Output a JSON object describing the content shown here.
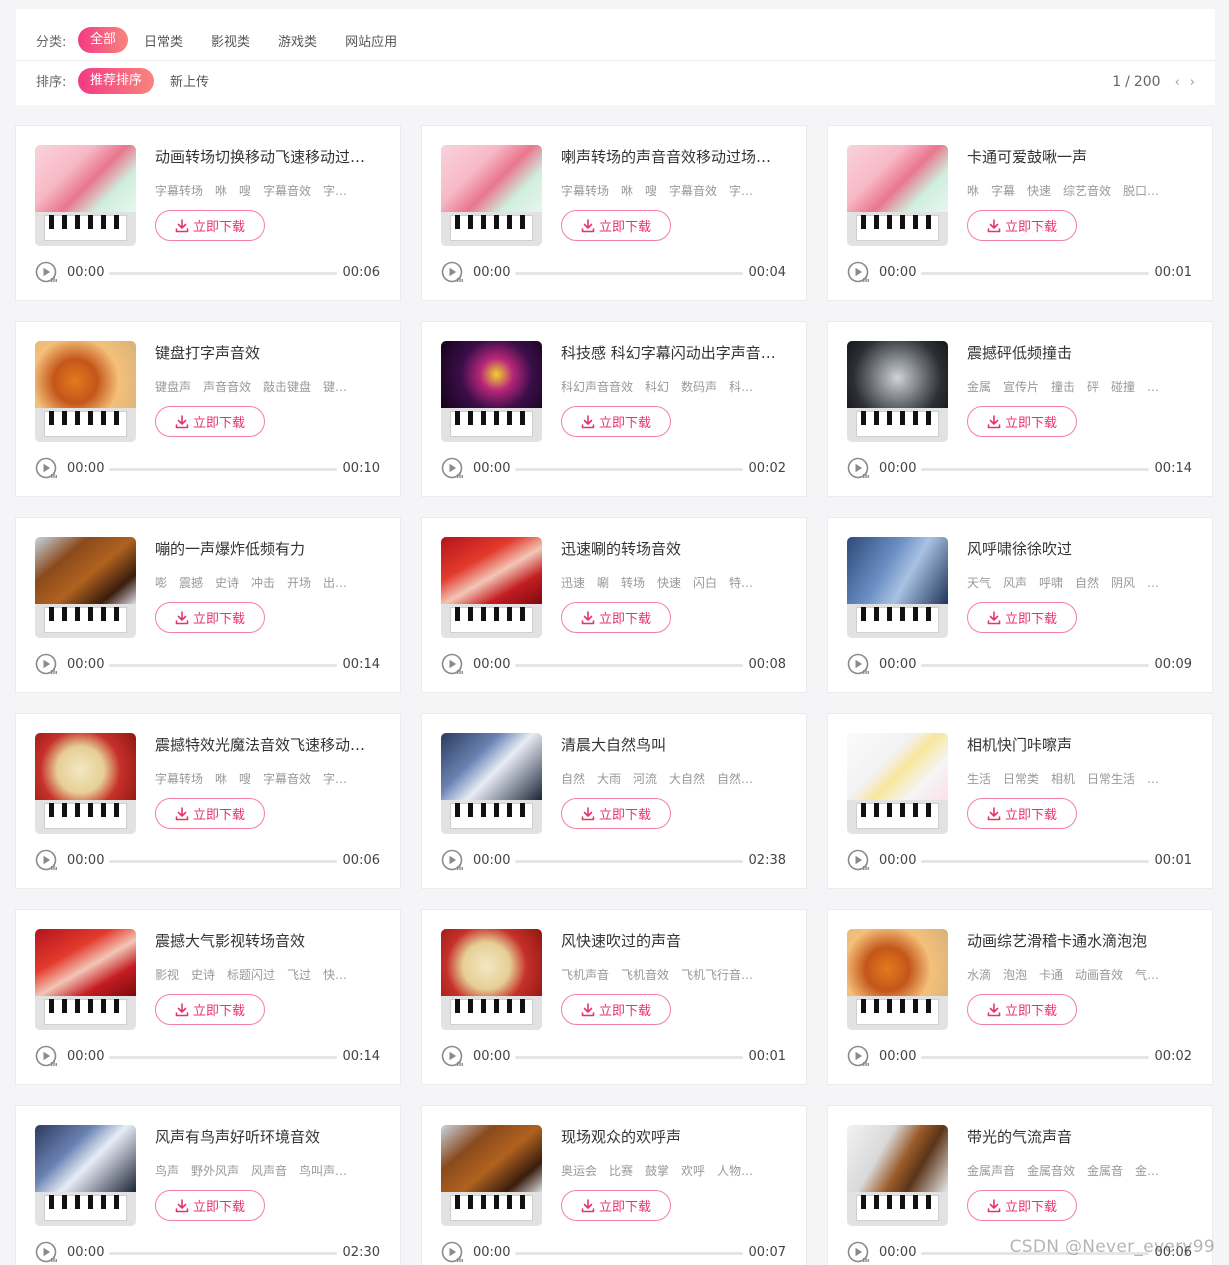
{
  "filters": {
    "category_label": "分类:",
    "categories": [
      "全部",
      "日常类",
      "影视类",
      "游戏类",
      "网站应用"
    ],
    "sort_label": "排序:",
    "sorts": [
      "推荐排序",
      "新上传"
    ],
    "pager": {
      "current": "1",
      "separator": "/",
      "total": "200"
    }
  },
  "download_label": "立即下载",
  "cards": [
    {
      "title": "动画转场切换移动飞速移动过…",
      "tags": "字幕转场　咻　嗖　字幕音效　字…",
      "start": "00:00",
      "duration": "00:06",
      "art": "flowers"
    },
    {
      "title": "喇声转场的声音音效移动过场…",
      "tags": "字幕转场　咻　嗖　字幕音效　字…",
      "start": "00:00",
      "duration": "00:04",
      "art": "flowers"
    },
    {
      "title": "卡通可爱鼓啾一声",
      "tags": "咻　字幕　快速　综艺音效　脱口…",
      "start": "00:00",
      "duration": "00:01",
      "art": "flowers"
    },
    {
      "title": "键盘打字声音效",
      "tags": "键盘声　声音音效　敲击键盘　键…",
      "start": "00:00",
      "duration": "00:10",
      "art": "ukulele"
    },
    {
      "title": "科技感 科幻字幕闪动出字声音…",
      "tags": "科幻声音音效　科幻　数码声　科…",
      "start": "00:00",
      "duration": "00:02",
      "art": "neon"
    },
    {
      "title": "震撼砰低频撞击",
      "tags": "金属　宣传片　撞击　砰　碰撞　…",
      "start": "00:00",
      "duration": "00:14",
      "art": "headphones"
    },
    {
      "title": "嘣的一声爆炸低频有力",
      "tags": "嘭　震撼　史诗　冲击　开场　出…",
      "start": "00:00",
      "duration": "00:14",
      "art": "violin"
    },
    {
      "title": "迅速唰的转场音效",
      "tags": "迅速　唰　转场　快速　闪白　特…",
      "start": "00:00",
      "duration": "00:08",
      "art": "harp"
    },
    {
      "title": "风呼啸徐徐吹过",
      "tags": "天气　风声　呼啸　自然　阴风　…",
      "start": "00:00",
      "duration": "00:09",
      "art": "accordion"
    },
    {
      "title": "震撼特效光魔法音效飞速移动…",
      "tags": "字幕转场　咻　嗖　字幕音效　字…",
      "start": "00:00",
      "duration": "00:06",
      "art": "drum"
    },
    {
      "title": "清晨大自然鸟叫",
      "tags": "自然　大雨　河流　大自然　自然…",
      "start": "00:00",
      "duration": "02:38",
      "art": "piano"
    },
    {
      "title": "相机快门咔嚓声",
      "tags": "生活　日常类　相机　日常生活　…",
      "start": "00:00",
      "duration": "00:01",
      "art": "daisies"
    },
    {
      "title": "震撼大气影视转场音效",
      "tags": "影视　史诗　标题闪过　飞过　快…",
      "start": "00:00",
      "duration": "00:14",
      "art": "harp"
    },
    {
      "title": "风快速吹过的声音",
      "tags": "飞机声音　飞机音效　飞机飞行音…",
      "start": "00:00",
      "duration": "00:01",
      "art": "drum"
    },
    {
      "title": "动画综艺滑稽卡通水滴泡泡",
      "tags": "水滴　泡泡　卡通　动画音效　气…",
      "start": "00:00",
      "duration": "00:02",
      "art": "ukulele"
    },
    {
      "title": "风声有鸟声好听环境音效",
      "tags": "鸟声　野外风声　风声音　鸟叫声…",
      "start": "00:00",
      "duration": "02:30",
      "art": "piano"
    },
    {
      "title": "现场观众的欢呼声",
      "tags": "奥运会　比赛　鼓掌　欢呼　人物…",
      "start": "00:00",
      "duration": "00:07",
      "art": "violin"
    },
    {
      "title": "带光的气流声音",
      "tags": "金属声音　金属音效　金属音　金…",
      "start": "00:00",
      "duration": "00:06",
      "art": "guitar"
    }
  ],
  "watermark": "CSDN @Never_every99"
}
